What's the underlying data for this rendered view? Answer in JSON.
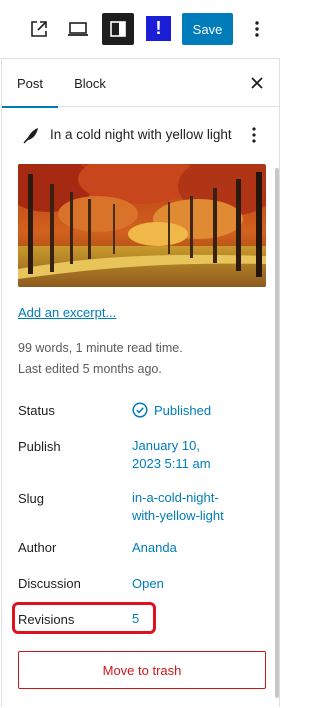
{
  "toolbar": {
    "save_label": "Save",
    "notice_label": "!"
  },
  "tabs": [
    {
      "label": "Post"
    },
    {
      "label": "Block"
    }
  ],
  "post": {
    "title": "In a cold night with yellow light",
    "excerpt_link": "Add an excerpt...",
    "stats_line": "99 words, 1 minute read time.",
    "last_edited": "Last edited 5 months ago."
  },
  "summary": [
    {
      "label": "Status",
      "value": "Published"
    },
    {
      "label": "Publish",
      "value_lines": [
        "January 10,",
        "2023 5:11 am"
      ]
    },
    {
      "label": "Slug",
      "value_lines": [
        "in-a-cold-night-",
        "with-yellow-light"
      ]
    },
    {
      "label": "Author",
      "value": "Ananda"
    },
    {
      "label": "Discussion",
      "value": "Open"
    },
    {
      "label": "Revisions",
      "value": "5"
    }
  ],
  "actions": {
    "trash_label": "Move to trash"
  },
  "colors": {
    "accent": "#007cba",
    "danger": "#cc1818",
    "highlight": "#e0111f",
    "notice": "#1a1ed6"
  }
}
